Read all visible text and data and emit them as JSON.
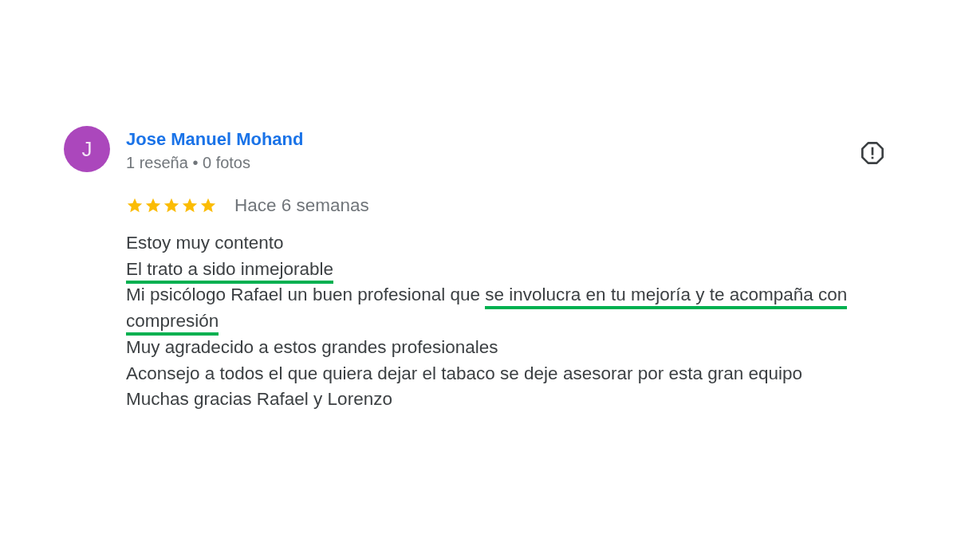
{
  "review": {
    "avatar_letter": "J",
    "author": "Jose Manuel Mohand",
    "meta": "1 reseña • 0 fotos",
    "stars": 5,
    "time": "Hace 6 semanas",
    "lines": [
      {
        "segments": [
          {
            "text": "Estoy muy contento",
            "underlined": false
          }
        ]
      },
      {
        "segments": [
          {
            "text": "El trato a sido inmejorable",
            "underlined": true
          }
        ]
      },
      {
        "segments": [
          {
            "text": "Mi psicólogo Rafael un buen profesional que ",
            "underlined": false
          },
          {
            "text": "se involucra en tu mejoría y te acompaña con compresión",
            "underlined": true
          }
        ]
      },
      {
        "segments": [
          {
            "text": "Muy agradecido a estos grandes profesionales",
            "underlined": false
          }
        ]
      },
      {
        "segments": [
          {
            "text": "Aconsejo a todos el que quiera dejar el tabaco se deje asesorar por esta gran equipo",
            "underlined": false
          }
        ]
      },
      {
        "segments": [
          {
            "text": "Muchas gracias Rafael y Lorenzo",
            "underlined": false
          }
        ]
      }
    ]
  }
}
